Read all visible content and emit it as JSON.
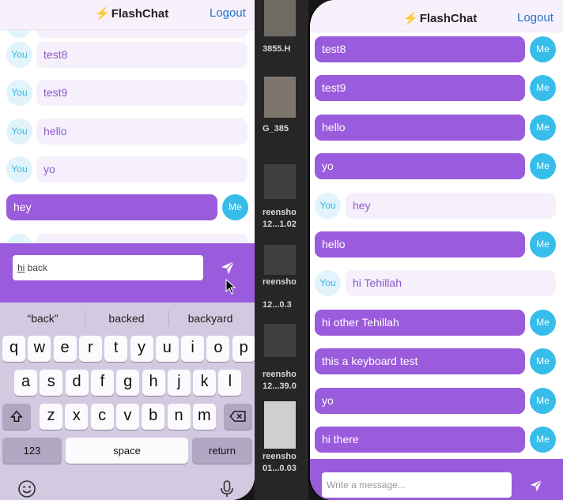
{
  "app": {
    "title": "FlashChat",
    "logout_label": "Logout",
    "colors": {
      "accent": "#9a5bdc",
      "avatar_me": "#37bde9",
      "logout": "#1a76d2"
    }
  },
  "left_phone": {
    "messages": [
      {
        "sender": "You",
        "text": "test8"
      },
      {
        "sender": "You",
        "text": "test9"
      },
      {
        "sender": "You",
        "text": "hello"
      },
      {
        "sender": "You",
        "text": "yo"
      },
      {
        "sender": "Me",
        "text": "hey"
      }
    ],
    "composer": {
      "value_underlined": "hi",
      "value_rest": " back"
    },
    "keyboard": {
      "suggestions": [
        "“back”",
        "backed",
        "backyard"
      ],
      "row1": [
        "q",
        "w",
        "e",
        "r",
        "t",
        "y",
        "u",
        "i",
        "o",
        "p"
      ],
      "row2": [
        "a",
        "s",
        "d",
        "f",
        "g",
        "h",
        "j",
        "k",
        "l"
      ],
      "row3": [
        "z",
        "x",
        "c",
        "v",
        "b",
        "n",
        "m"
      ],
      "numbers_label": "123",
      "space_label": "space",
      "return_label": "return",
      "shift_icon": "shift-icon",
      "delete_icon": "delete-icon",
      "emoji_icon": "emoji-icon",
      "mic_icon": "microphone-icon"
    }
  },
  "files_strip": {
    "labels": [
      "3855.H",
      "G_385",
      "reensho",
      "12...1.02",
      "reensho",
      "12...0.3",
      "reensho",
      "12...39.0",
      "reensho",
      "01...0.03"
    ]
  },
  "right_phone": {
    "messages": [
      {
        "sender": "Me",
        "text": "test8"
      },
      {
        "sender": "Me",
        "text": "test9"
      },
      {
        "sender": "Me",
        "text": "hello"
      },
      {
        "sender": "Me",
        "text": "yo"
      },
      {
        "sender": "You",
        "text": "hey"
      },
      {
        "sender": "Me",
        "text": "hello"
      },
      {
        "sender": "You",
        "text": "hi Tehillah"
      },
      {
        "sender": "Me",
        "text": "hi other Tehillah"
      },
      {
        "sender": "Me",
        "text": "this a keyboard test"
      },
      {
        "sender": "Me",
        "text": "yo"
      },
      {
        "sender": "Me",
        "text": "hi there"
      }
    ],
    "composer": {
      "placeholder": "Write a message..."
    }
  }
}
